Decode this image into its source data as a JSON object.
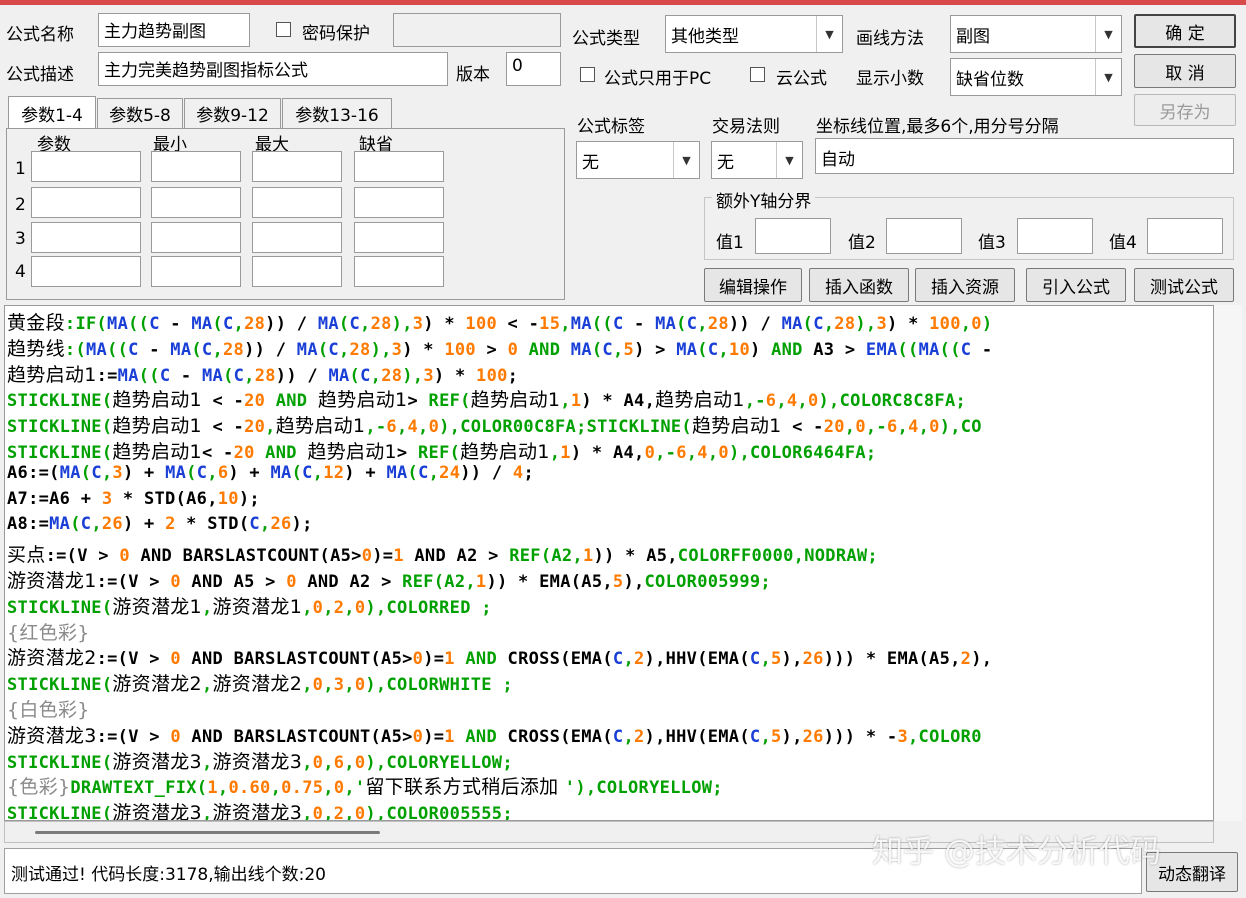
{
  "form": {
    "name_label": "公式名称",
    "name_value": "主力趋势副图",
    "password_label": "密码保护",
    "desc_label": "公式描述",
    "desc_value": "主力完美趋势副图指标公式",
    "version_label": "版本",
    "version_value": "0",
    "type_label": "公式类型",
    "type_value": "其他类型",
    "draw_label": "画线方法",
    "draw_value": "副图",
    "pc_only_label": "公式只用于PC",
    "cloud_label": "云公式",
    "decimals_label": "显示小数",
    "decimals_value": "缺省位数",
    "tag_label": "公式标签",
    "tag_value": "无",
    "rule_label": "交易法则",
    "rule_value": "无",
    "axis_label": "坐标线位置,最多6个,用分号分隔",
    "axis_value": "自动",
    "yaxis_group_label": "额外Y轴分界",
    "y_labels": [
      "值1",
      "值2",
      "值3",
      "值4"
    ]
  },
  "buttons": {
    "ok": "确  定",
    "cancel": "取  消",
    "save_as": "另存为",
    "edit_ops": "编辑操作",
    "insert_func": "插入函数",
    "insert_res": "插入资源",
    "import_formula": "引入公式",
    "test_formula": "测试公式",
    "dyn_translate": "动态翻译"
  },
  "tabs": [
    "参数1-4",
    "参数5-8",
    "参数9-12",
    "参数13-16"
  ],
  "params": {
    "headers": [
      "参数",
      "最小",
      "最大",
      "缺省"
    ],
    "rows": [
      "1",
      "2",
      "3",
      "4"
    ]
  },
  "code": [
    [
      [
        "黄金段",
        "k",
        1
      ],
      [
        ":IF(",
        "g"
      ],
      [
        "MA",
        "b"
      ],
      [
        "((",
        "g"
      ],
      [
        "C",
        "b"
      ],
      [
        " - ",
        "k"
      ],
      [
        "MA",
        "b"
      ],
      [
        "(",
        "g"
      ],
      [
        "C",
        "b"
      ],
      [
        ",",
        "g"
      ],
      [
        "28",
        "o"
      ],
      [
        ")) / ",
        "k"
      ],
      [
        "MA",
        "b"
      ],
      [
        "(",
        "g"
      ],
      [
        "C",
        "b"
      ],
      [
        ",",
        "g"
      ],
      [
        "28",
        "o"
      ],
      [
        "),",
        "g"
      ],
      [
        "3",
        "o"
      ],
      [
        ") * ",
        "k"
      ],
      [
        "100",
        "o"
      ],
      [
        " < -",
        "k"
      ],
      [
        "15",
        "o"
      ],
      [
        ",",
        "g"
      ],
      [
        "MA",
        "b"
      ],
      [
        "((",
        "g"
      ],
      [
        "C",
        "b"
      ],
      [
        " - ",
        "k"
      ],
      [
        "MA",
        "b"
      ],
      [
        "(",
        "g"
      ],
      [
        "C",
        "b"
      ],
      [
        ",",
        "g"
      ],
      [
        "28",
        "o"
      ],
      [
        ")) / ",
        "k"
      ],
      [
        "MA",
        "b"
      ],
      [
        "(",
        "g"
      ],
      [
        "C",
        "b"
      ],
      [
        ",",
        "g"
      ],
      [
        "28",
        "o"
      ],
      [
        "),",
        "g"
      ],
      [
        "3",
        "o"
      ],
      [
        ") * ",
        "k"
      ],
      [
        "100",
        "o"
      ],
      [
        ",",
        "g"
      ],
      [
        "0",
        "o"
      ],
      [
        ")",
        "g"
      ]
    ],
    [
      [
        "趋势线",
        "k",
        1
      ],
      [
        ":(",
        "g"
      ],
      [
        "MA",
        "b"
      ],
      [
        "((",
        "g"
      ],
      [
        "C",
        "b"
      ],
      [
        " - ",
        "k"
      ],
      [
        "MA",
        "b"
      ],
      [
        "(",
        "g"
      ],
      [
        "C",
        "b"
      ],
      [
        ",",
        "g"
      ],
      [
        "28",
        "o"
      ],
      [
        ")) / ",
        "k"
      ],
      [
        "MA",
        "b"
      ],
      [
        "(",
        "g"
      ],
      [
        "C",
        "b"
      ],
      [
        ",",
        "g"
      ],
      [
        "28",
        "o"
      ],
      [
        "),",
        "g"
      ],
      [
        "3",
        "o"
      ],
      [
        ") * ",
        "k"
      ],
      [
        "100",
        "o"
      ],
      [
        " > ",
        "k"
      ],
      [
        "0",
        "o"
      ],
      [
        " AND ",
        "g"
      ],
      [
        "MA",
        "b"
      ],
      [
        "(",
        "g"
      ],
      [
        "C",
        "b"
      ],
      [
        ",",
        "g"
      ],
      [
        "5",
        "o"
      ],
      [
        ") > ",
        "k"
      ],
      [
        "MA",
        "b"
      ],
      [
        "(",
        "g"
      ],
      [
        "C",
        "b"
      ],
      [
        ",",
        "g"
      ],
      [
        "10",
        "o"
      ],
      [
        ") ",
        "k"
      ],
      [
        "AND",
        "g"
      ],
      [
        " A3 > ",
        "k"
      ],
      [
        "EMA",
        "b"
      ],
      [
        "((",
        "g"
      ],
      [
        "MA",
        "b"
      ],
      [
        "((",
        "g"
      ],
      [
        "C",
        "b"
      ],
      [
        " -",
        "k"
      ]
    ],
    [
      [
        "趋势启动1",
        "k",
        1
      ],
      [
        ":=",
        "k"
      ],
      [
        "MA",
        "b"
      ],
      [
        "((",
        "g"
      ],
      [
        "C",
        "b"
      ],
      [
        " - ",
        "k"
      ],
      [
        "MA",
        "b"
      ],
      [
        "(",
        "g"
      ],
      [
        "C",
        "b"
      ],
      [
        ",",
        "g"
      ],
      [
        "28",
        "o"
      ],
      [
        ")) / ",
        "k"
      ],
      [
        "MA",
        "b"
      ],
      [
        "(",
        "g"
      ],
      [
        "C",
        "b"
      ],
      [
        ",",
        "g"
      ],
      [
        "28",
        "o"
      ],
      [
        "),",
        "g"
      ],
      [
        "3",
        "o"
      ],
      [
        ") * ",
        "k"
      ],
      [
        "100",
        "o"
      ],
      [
        ";",
        "k"
      ]
    ],
    [
      [
        "STICKLINE(",
        "g"
      ],
      [
        "趋势启动1",
        "k",
        1
      ],
      [
        " < -",
        "k"
      ],
      [
        "20",
        "o"
      ],
      [
        " AND ",
        "g"
      ],
      [
        "趋势启动1",
        "k",
        1
      ],
      [
        "> ",
        "k"
      ],
      [
        "REF(",
        "g"
      ],
      [
        "趋势启动1",
        "k",
        1
      ],
      [
        ",",
        "g"
      ],
      [
        "1",
        "o"
      ],
      [
        ") * A4,",
        "k"
      ],
      [
        "趋势启动1",
        "k",
        1
      ],
      [
        ",-",
        "g"
      ],
      [
        "6",
        "o"
      ],
      [
        ",",
        "g"
      ],
      [
        "4",
        "o"
      ],
      [
        ",",
        "g"
      ],
      [
        "0",
        "o"
      ],
      [
        "),",
        "g"
      ],
      [
        "COLORC8C8FA;",
        "g"
      ]
    ],
    [
      [
        "STICKLINE(",
        "g"
      ],
      [
        "趋势启动1",
        "k",
        1
      ],
      [
        " < -",
        "k"
      ],
      [
        "20",
        "o"
      ],
      [
        ",",
        "g"
      ],
      [
        "趋势启动1",
        "k",
        1
      ],
      [
        ",-",
        "g"
      ],
      [
        "6",
        "o"
      ],
      [
        ",",
        "g"
      ],
      [
        "4",
        "o"
      ],
      [
        ",",
        "g"
      ],
      [
        "0",
        "o"
      ],
      [
        "),",
        "g"
      ],
      [
        "COLOR00C8FA;STICKLINE(",
        "g"
      ],
      [
        "趋势启动1",
        "k",
        1
      ],
      [
        " < -",
        "k"
      ],
      [
        "20",
        "o"
      ],
      [
        ",",
        "g"
      ],
      [
        "0",
        "o"
      ],
      [
        ",-",
        "g"
      ],
      [
        "6",
        "o"
      ],
      [
        ",",
        "g"
      ],
      [
        "4",
        "o"
      ],
      [
        ",",
        "g"
      ],
      [
        "0",
        "o"
      ],
      [
        "),CO",
        "g"
      ]
    ],
    [
      [
        "STICKLINE(",
        "g"
      ],
      [
        "趋势启动1",
        "k",
        1
      ],
      [
        "< -",
        "k"
      ],
      [
        "20",
        "o"
      ],
      [
        " AND ",
        "g"
      ],
      [
        "趋势启动1",
        "k",
        1
      ],
      [
        "> ",
        "k"
      ],
      [
        "REF(",
        "g"
      ],
      [
        "趋势启动1",
        "k",
        1
      ],
      [
        ",",
        "g"
      ],
      [
        "1",
        "o"
      ],
      [
        ") * A4,",
        "k"
      ],
      [
        "0",
        "o"
      ],
      [
        ",-",
        "g"
      ],
      [
        "6",
        "o"
      ],
      [
        ",",
        "g"
      ],
      [
        "4",
        "o"
      ],
      [
        ",",
        "g"
      ],
      [
        "0",
        "o"
      ],
      [
        "),",
        "g"
      ],
      [
        "COLOR6464FA;",
        "g"
      ]
    ],
    [
      [
        "A6:=(",
        "k"
      ],
      [
        "MA",
        "b"
      ],
      [
        "(",
        "g"
      ],
      [
        "C",
        "b"
      ],
      [
        ",",
        "g"
      ],
      [
        "3",
        "o"
      ],
      [
        ") + ",
        "k"
      ],
      [
        "MA",
        "b"
      ],
      [
        "(",
        "g"
      ],
      [
        "C",
        "b"
      ],
      [
        ",",
        "g"
      ],
      [
        "6",
        "o"
      ],
      [
        ") + ",
        "k"
      ],
      [
        "MA",
        "b"
      ],
      [
        "(",
        "g"
      ],
      [
        "C",
        "b"
      ],
      [
        ",",
        "g"
      ],
      [
        "12",
        "o"
      ],
      [
        ") + ",
        "k"
      ],
      [
        "MA",
        "b"
      ],
      [
        "(",
        "g"
      ],
      [
        "C",
        "b"
      ],
      [
        ",",
        "g"
      ],
      [
        "24",
        "o"
      ],
      [
        ")) / ",
        "k"
      ],
      [
        "4",
        "o"
      ],
      [
        ";",
        "k"
      ]
    ],
    [
      [
        "A7:=A6 + ",
        "k"
      ],
      [
        "3",
        "o"
      ],
      [
        " * ",
        "k"
      ],
      [
        "STD(A6,",
        "k"
      ],
      [
        "10",
        "o"
      ],
      [
        ");",
        "k"
      ]
    ],
    [
      [
        "A8:=",
        "k"
      ],
      [
        "MA",
        "b"
      ],
      [
        "(",
        "g"
      ],
      [
        "C",
        "b"
      ],
      [
        ",",
        "g"
      ],
      [
        "26",
        "o"
      ],
      [
        ") + ",
        "k"
      ],
      [
        "2",
        "o"
      ],
      [
        " * ",
        "k"
      ],
      [
        "STD(",
        "k"
      ],
      [
        "C",
        "b"
      ],
      [
        ",",
        "g"
      ],
      [
        "26",
        "o"
      ],
      [
        ");",
        "k"
      ]
    ],
    [
      [
        "买点",
        "k",
        1
      ],
      [
        ":=(V > ",
        "k"
      ],
      [
        "0",
        "o"
      ],
      [
        " AND BARSLASTCOUNT(A5>",
        "k"
      ],
      [
        "0",
        "o"
      ],
      [
        ")=",
        "k"
      ],
      [
        "1",
        "o"
      ],
      [
        " AND A2 > ",
        "k"
      ],
      [
        "REF(A2,",
        "g"
      ],
      [
        "1",
        "o"
      ],
      [
        ")) * A5,",
        "k"
      ],
      [
        "COLORFF0000,NODRAW;",
        "g"
      ]
    ],
    [
      [
        "游资潜龙1",
        "k",
        1
      ],
      [
        ":=(V > ",
        "k"
      ],
      [
        "0",
        "o"
      ],
      [
        " AND A5 > ",
        "k"
      ],
      [
        "0",
        "o"
      ],
      [
        " AND A2 > ",
        "k"
      ],
      [
        "REF(A2,",
        "g"
      ],
      [
        "1",
        "o"
      ],
      [
        ")) * ",
        "k"
      ],
      [
        "EMA(A5,",
        "k"
      ],
      [
        "5",
        "o"
      ],
      [
        "),",
        "k"
      ],
      [
        "COLOR005999;",
        "g"
      ]
    ],
    [
      [
        "STICKLINE(",
        "g"
      ],
      [
        "游资潜龙1",
        "k",
        1
      ],
      [
        ",",
        "g"
      ],
      [
        "游资潜龙1",
        "k",
        1
      ],
      [
        ",",
        "g"
      ],
      [
        "0",
        "o"
      ],
      [
        ",",
        "g"
      ],
      [
        "2",
        "o"
      ],
      [
        ",",
        "g"
      ],
      [
        "0",
        "o"
      ],
      [
        "),",
        "g"
      ],
      [
        "COLORRED ;",
        "g"
      ]
    ],
    [
      [
        "{红色彩}",
        "c",
        1
      ]
    ],
    [
      [
        "游资潜龙2",
        "k",
        1
      ],
      [
        ":=(V > ",
        "k"
      ],
      [
        "0",
        "o"
      ],
      [
        " AND BARSLASTCOUNT(A5>",
        "k"
      ],
      [
        "0",
        "o"
      ],
      [
        ")=",
        "k"
      ],
      [
        "1",
        "o"
      ],
      [
        " AND ",
        "g"
      ],
      [
        "CROSS(EMA(",
        "k"
      ],
      [
        "C",
        "b"
      ],
      [
        ",",
        "g"
      ],
      [
        "2",
        "o"
      ],
      [
        "),HHV(EMA(",
        "k"
      ],
      [
        "C",
        "b"
      ],
      [
        ",",
        "g"
      ],
      [
        "5",
        "o"
      ],
      [
        "),",
        "k"
      ],
      [
        "26",
        "o"
      ],
      [
        "))) * ",
        "k"
      ],
      [
        "EMA(A5,",
        "k"
      ],
      [
        "2",
        "o"
      ],
      [
        "),",
        "k"
      ]
    ],
    [
      [
        "STICKLINE(",
        "g"
      ],
      [
        "游资潜龙2",
        "k",
        1
      ],
      [
        ",",
        "g"
      ],
      [
        "游资潜龙2",
        "k",
        1
      ],
      [
        ",",
        "g"
      ],
      [
        "0",
        "o"
      ],
      [
        ",",
        "g"
      ],
      [
        "3",
        "o"
      ],
      [
        ",",
        "g"
      ],
      [
        "0",
        "o"
      ],
      [
        "),",
        "g"
      ],
      [
        "COLORWHITE ;",
        "g"
      ]
    ],
    [
      [
        "{白色彩}",
        "c",
        1
      ]
    ],
    [
      [
        "游资潜龙3",
        "k",
        1
      ],
      [
        ":=(V > ",
        "k"
      ],
      [
        "0",
        "o"
      ],
      [
        " AND BARSLASTCOUNT(A5>",
        "k"
      ],
      [
        "0",
        "o"
      ],
      [
        ")=",
        "k"
      ],
      [
        "1",
        "o"
      ],
      [
        " AND ",
        "g"
      ],
      [
        "CROSS(EMA(",
        "k"
      ],
      [
        "C",
        "b"
      ],
      [
        ",",
        "g"
      ],
      [
        "2",
        "o"
      ],
      [
        "),HHV(EMA(",
        "k"
      ],
      [
        "C",
        "b"
      ],
      [
        ",",
        "g"
      ],
      [
        "5",
        "o"
      ],
      [
        "),",
        "k"
      ],
      [
        "26",
        "o"
      ],
      [
        "))) * -",
        "k"
      ],
      [
        "3",
        "o"
      ],
      [
        ",",
        "g"
      ],
      [
        "COLOR0",
        "g"
      ]
    ],
    [
      [
        "STICKLINE(",
        "g"
      ],
      [
        "游资潜龙3",
        "k",
        1
      ],
      [
        ",",
        "g"
      ],
      [
        "游资潜龙3",
        "k",
        1
      ],
      [
        ",",
        "g"
      ],
      [
        "0",
        "o"
      ],
      [
        ",",
        "g"
      ],
      [
        "6",
        "o"
      ],
      [
        ",",
        "g"
      ],
      [
        "0",
        "o"
      ],
      [
        "),",
        "g"
      ],
      [
        "COLORYELLOW;",
        "g"
      ]
    ],
    [
      [
        "{色彩}",
        "c",
        1
      ],
      [
        "DRAWTEXT_FIX(",
        "g"
      ],
      [
        "1",
        "o"
      ],
      [
        ",",
        "g"
      ],
      [
        "0.60",
        "o"
      ],
      [
        ",",
        "g"
      ],
      [
        "0.75",
        "o"
      ],
      [
        ",",
        "g"
      ],
      [
        "0",
        "o"
      ],
      [
        ",'",
        "g"
      ],
      [
        "留下联系方式稍后添加 ",
        "k",
        1
      ],
      [
        "'),",
        "g"
      ],
      [
        "COLORYELLOW;",
        "g"
      ]
    ],
    [
      [
        "STICKLINE(",
        "g"
      ],
      [
        "游资潜龙3",
        "k",
        1
      ],
      [
        ",",
        "g"
      ],
      [
        "游资潜龙3",
        "k",
        1
      ],
      [
        ",",
        "g"
      ],
      [
        "0",
        "o"
      ],
      [
        ",",
        "g"
      ],
      [
        "2",
        "o"
      ],
      [
        ",",
        "g"
      ],
      [
        "0",
        "o"
      ],
      [
        "),",
        "g"
      ],
      [
        "COLOR005555;",
        "g"
      ]
    ]
  ],
  "code_colors": {
    "k": "#000000",
    "g": "#00a000",
    "b": "#1a3fd6",
    "o": "#ff7a00",
    "c": "#8a8a8a"
  },
  "status_text": "测试通过! 代码长度:3178,输出线个数:20",
  "watermark": "知乎 @技术分析代码"
}
